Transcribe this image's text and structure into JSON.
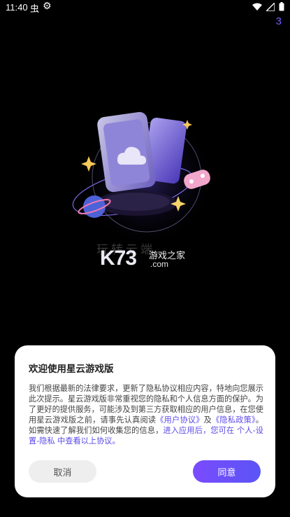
{
  "status_bar": {
    "time": "11:40",
    "icons": [
      "bug-icon",
      "gear-icon",
      "wifi-icon",
      "signal-icon",
      "battery-icon"
    ]
  },
  "splash": {
    "countdown": "3",
    "watermark_brand": "K73",
    "watermark_site": "游戏之家",
    "watermark_domain": ".com",
    "ghost_text": "玩转云端"
  },
  "dialog": {
    "title": "欢迎使用星云游戏版",
    "body_part1": "我们根据最新的法律要求，更新了隐私协议相应内容，特地向您展示此次提示。星云游戏版非常重视您的隐私和个人信息方面的保护。为了更好的提供服务，可能涉及到第三方获取相应的用户信息，在您使用星云游戏版之前，请事先认真阅读",
    "user_agreement_link": "《用户协议》",
    "and_text": "及",
    "privacy_policy_link": "《隐私政策》",
    "body_part2": "。如需快速了解我们如何收集您的信息，",
    "settings_hint": "进入应用后，您可在 个人-设置-隐私 中查看以上协议。",
    "cancel_label": "取消",
    "agree_label": "同意"
  },
  "colors": {
    "accent": "#5b4be8",
    "agree_gradient_start": "#7a4bff",
    "agree_gradient_end": "#5b54f5",
    "background": "#000000"
  }
}
